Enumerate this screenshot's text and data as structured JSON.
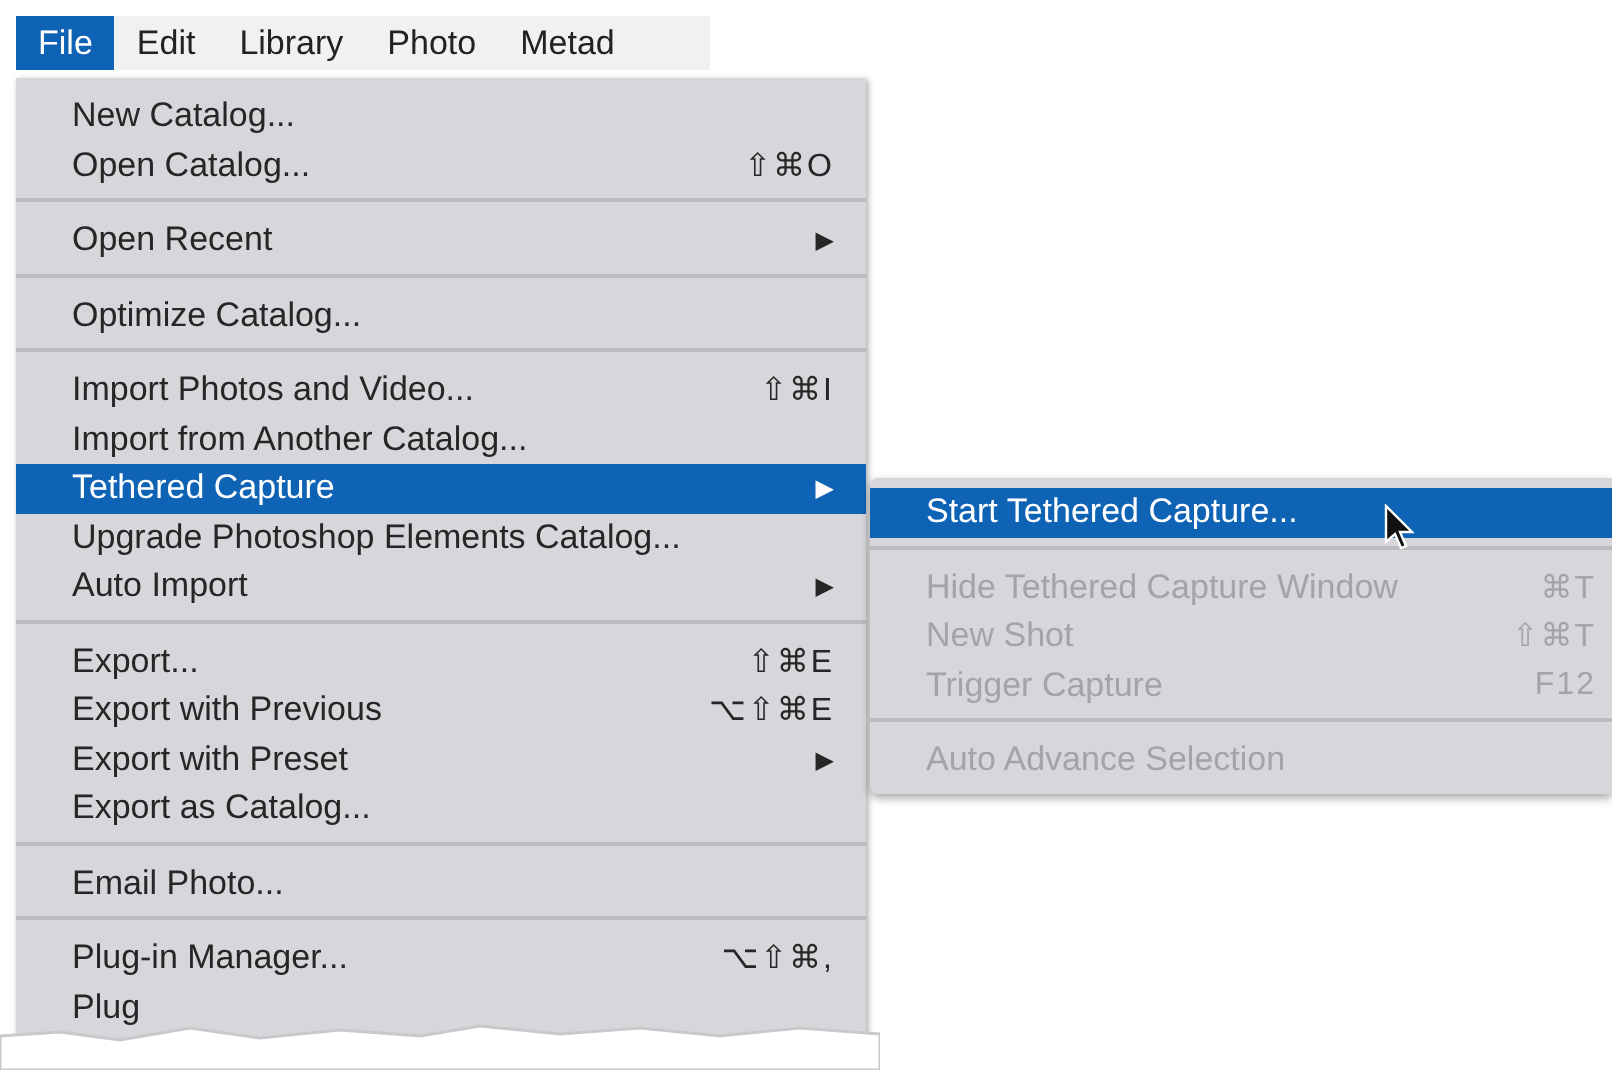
{
  "menubar": [
    {
      "label": "File",
      "selected": true
    },
    {
      "label": "Edit",
      "selected": false
    },
    {
      "label": "Library",
      "selected": false
    },
    {
      "label": "Photo",
      "selected": false
    },
    {
      "label": "Metad",
      "selected": false
    }
  ],
  "menu": {
    "groups": [
      [
        {
          "label": "New Catalog...",
          "selected": false
        },
        {
          "label": "Open Catalog...",
          "shortcut": "⇧⌘O",
          "selected": false
        }
      ],
      [
        {
          "label": "Open Recent",
          "arrow": "▶",
          "selected": false
        }
      ],
      [
        {
          "label": "Optimize Catalog...",
          "selected": false
        }
      ],
      [
        {
          "label": "Import Photos and Video...",
          "shortcut": "⇧⌘I",
          "selected": false
        },
        {
          "label": "Import from Another Catalog...",
          "selected": false
        },
        {
          "label": "Tethered Capture",
          "arrow": "▶",
          "selected": true
        },
        {
          "label": "Upgrade Photoshop Elements Catalog...",
          "selected": false
        },
        {
          "label": "Auto Import",
          "arrow": "▶",
          "selected": false
        }
      ],
      [
        {
          "label": "Export...",
          "shortcut": "⇧⌘E",
          "selected": false
        },
        {
          "label": "Export with Previous",
          "shortcut": "⌥⇧⌘E",
          "selected": false
        },
        {
          "label": "Export with Preset",
          "arrow": "▶",
          "selected": false
        },
        {
          "label": "Export as Catalog...",
          "selected": false
        }
      ],
      [
        {
          "label": "Email Photo...",
          "selected": false
        }
      ],
      [
        {
          "label": "Plug-in Manager...",
          "shortcut": "⌥⇧⌘,",
          "selected": false
        },
        {
          "label": "Plug",
          "selected": false
        }
      ]
    ]
  },
  "submenu": {
    "groups": [
      [
        {
          "label": "Start Tethered Capture...",
          "selected": true,
          "disabled": false
        }
      ],
      [
        {
          "label": "Hide Tethered Capture Window",
          "shortcut": "⌘T",
          "selected": false,
          "disabled": true
        },
        {
          "label": "New Shot",
          "shortcut": "⇧⌘T",
          "selected": false,
          "disabled": true
        },
        {
          "label": "Trigger Capture",
          "shortcut": "F12",
          "selected": false,
          "disabled": true
        }
      ],
      [
        {
          "label": "Auto Advance Selection",
          "selected": false,
          "disabled": true
        }
      ]
    ]
  }
}
